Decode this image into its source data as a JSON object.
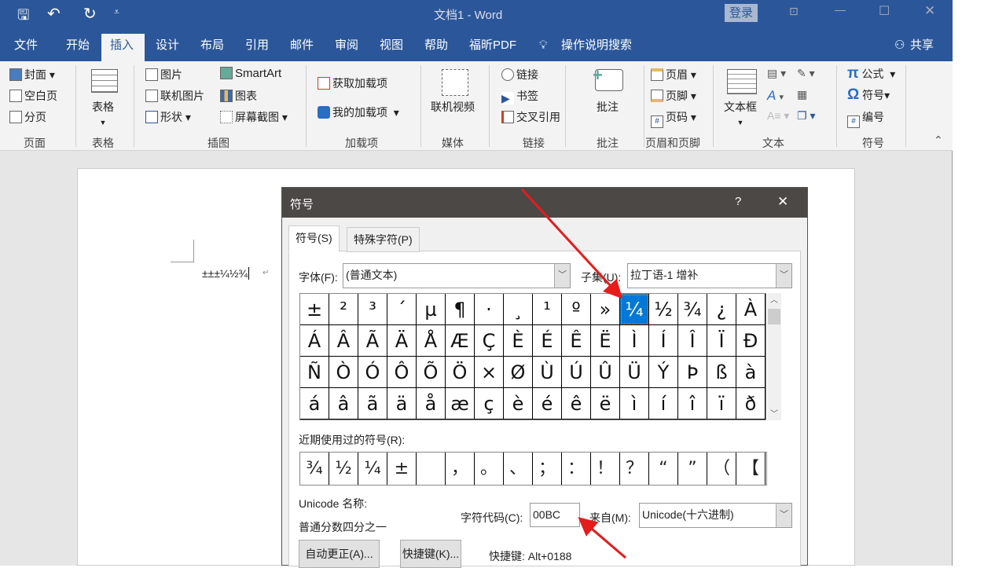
{
  "window": {
    "title": "文档1  -  Word",
    "login": "登录",
    "share": "共享"
  },
  "menu_tabs": [
    "文件",
    "开始",
    "插入",
    "设计",
    "布局",
    "引用",
    "邮件",
    "审阅",
    "视图",
    "帮助",
    "福昕PDF"
  ],
  "search_label": "操作说明搜索",
  "ribbon": {
    "page": {
      "items": [
        "封面",
        "空白页",
        "分页"
      ],
      "label": "页面"
    },
    "table": {
      "button": "表格",
      "label": "表格"
    },
    "illus": {
      "items": [
        "图片",
        "联机图片",
        "形状",
        "SmartArt",
        "图表",
        "屏幕截图"
      ],
      "label": "插图"
    },
    "addins": {
      "items": [
        "获取加载项",
        "我的加载项"
      ],
      "label": "加载项"
    },
    "media": {
      "button": "联机视频",
      "label": "媒体"
    },
    "links": {
      "items": [
        "链接",
        "书签",
        "交叉引用"
      ],
      "label": "链接"
    },
    "comment": {
      "button": "批注",
      "label": "批注"
    },
    "hf": {
      "items": [
        "页眉",
        "页脚",
        "页码"
      ],
      "label": "页眉和页脚"
    },
    "text": {
      "button": "文本框",
      "label": "文本"
    },
    "symbols": {
      "items": [
        "公式",
        "符号",
        "编号"
      ],
      "label": "符号"
    }
  },
  "document": {
    "text": "±±±¼½¾"
  },
  "dialog": {
    "title": "符号",
    "help": "?",
    "close": "X",
    "tabs": [
      "符号(S)",
      "特殊字符(P)"
    ],
    "font_label": "字体(F):",
    "font_value": "(普通文本)",
    "subset_label": "子集(U):",
    "subset_value": "拉丁语-1 增补",
    "symbols": [
      "±",
      "²",
      "³",
      "´",
      "µ",
      "¶",
      "·",
      "¸",
      "¹",
      "º",
      "»",
      "¼",
      "½",
      "¾",
      "¿",
      "À",
      "Á",
      "Â",
      "Ã",
      "Ä",
      "Å",
      "Æ",
      "Ç",
      "È",
      "É",
      "Ê",
      "Ë",
      "Ì",
      "Í",
      "Î",
      "Ï",
      "Ð",
      "Ñ",
      "Ò",
      "Ó",
      "Ô",
      "Õ",
      "Ö",
      "×",
      "Ø",
      "Ù",
      "Ú",
      "Û",
      "Ü",
      "Ý",
      "Þ",
      "ß",
      "à",
      "á",
      "â",
      "ã",
      "ä",
      "å",
      "æ",
      "ç",
      "è",
      "é",
      "ê",
      "ë",
      "ì",
      "í",
      "î",
      "ï",
      "ð"
    ],
    "selected_index": 11,
    "recent_label": "近期使用过的符号(R):",
    "recent": [
      "¾",
      "½",
      "¼",
      "±",
      " ",
      "，",
      "。",
      "、",
      "；",
      "：",
      "！",
      "？",
      "“",
      "”",
      "（",
      "【"
    ],
    "unicode_name_label": "Unicode 名称:",
    "unicode_name": "普通分数四分之一",
    "code_label": "字符代码(C):",
    "code_value": "00BC",
    "from_label": "来自(M):",
    "from_value": "Unicode(十六进制)",
    "autocorrect": "自动更正(A)...",
    "shortcut_btn": "快捷键(K)...",
    "shortcut_text": "快捷键: Alt+0188"
  },
  "colors": {
    "brand": "#2b579a",
    "selection": "#0078d7",
    "arrow": "#e51c1c"
  }
}
